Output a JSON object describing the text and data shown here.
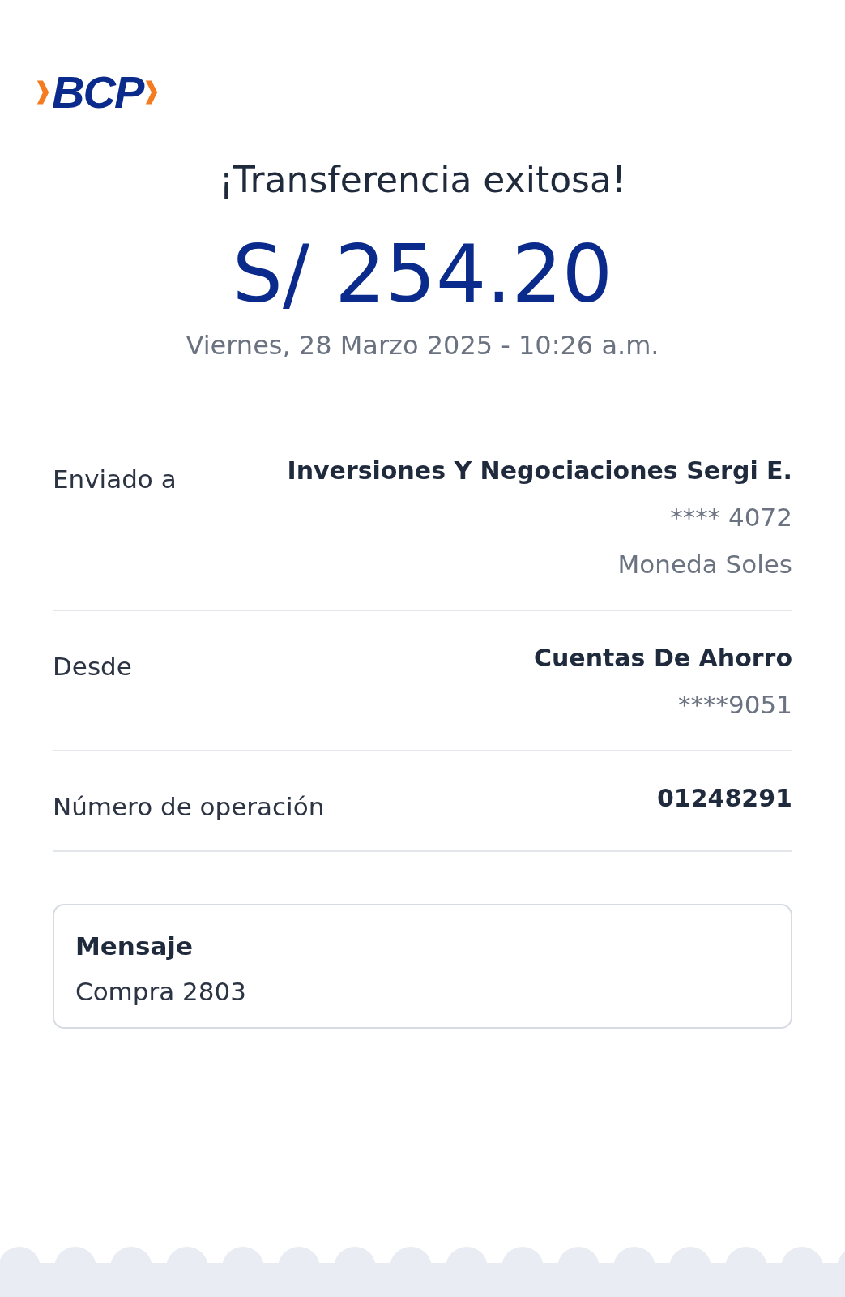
{
  "logo": {
    "text": "BCP"
  },
  "title": "¡Transferencia exitosa!",
  "amount": "S/ 254.20",
  "date": "Viernes, 28 Marzo 2025 - 10:26 a.m.",
  "details": [
    {
      "label": "Enviado a",
      "lines": [
        {
          "text": "Inversiones Y Negociaciones Sergi E.",
          "kind": "strong"
        },
        {
          "text": "**** 4072",
          "kind": "muted"
        },
        {
          "text": "Moneda Soles",
          "kind": "muted"
        }
      ]
    },
    {
      "label": "Desde",
      "lines": [
        {
          "text": "Cuentas De Ahorro",
          "kind": "strong"
        },
        {
          "text": "****9051",
          "kind": "muted"
        }
      ]
    },
    {
      "label": "Número de operación",
      "lines": [
        {
          "text": "01248291",
          "kind": "strong"
        }
      ]
    }
  ],
  "message": {
    "label": "Mensaje",
    "value": "Compra 2803"
  }
}
